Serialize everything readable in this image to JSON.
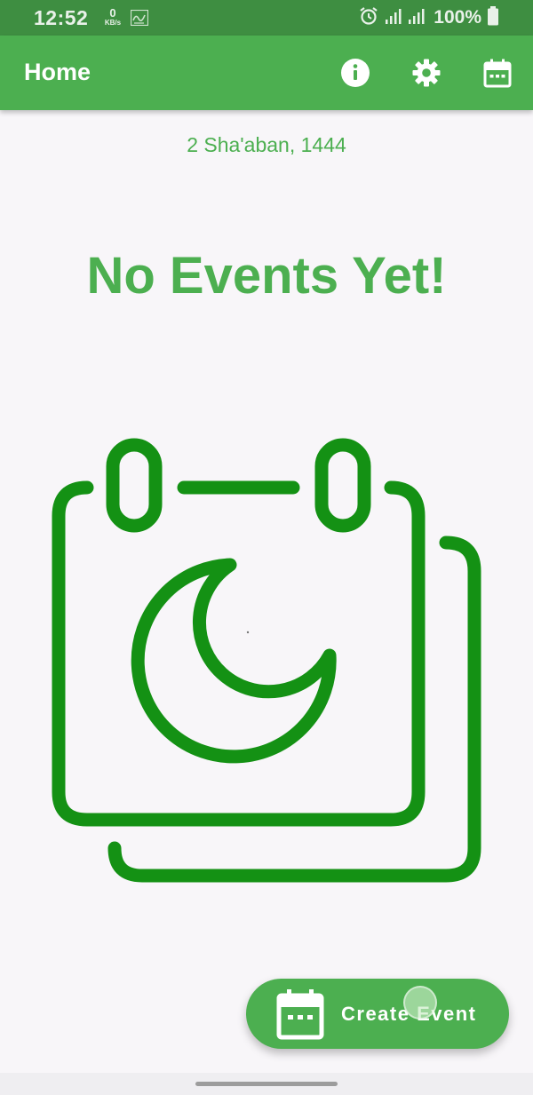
{
  "status_bar": {
    "time": "12:52",
    "net_speed_value": "0",
    "net_speed_unit": "KB/s",
    "battery": "100%",
    "icons": [
      "app-notification-icon",
      "alarm-icon",
      "signal-icon",
      "signal-icon",
      "battery-icon"
    ]
  },
  "app_bar": {
    "title": "Home",
    "actions": [
      "info-icon",
      "settings-icon",
      "calendar-icon"
    ],
    "color": "#4caf50"
  },
  "main": {
    "hijri_date": "2 Sha'aban, 1444",
    "empty_title": "No Events Yet!",
    "illustration": "calendar-with-crescent-moon",
    "accent_color": "#4caf50",
    "illustration_color": "#149114"
  },
  "fab": {
    "label": "Create Event",
    "icon": "calendar-icon"
  }
}
